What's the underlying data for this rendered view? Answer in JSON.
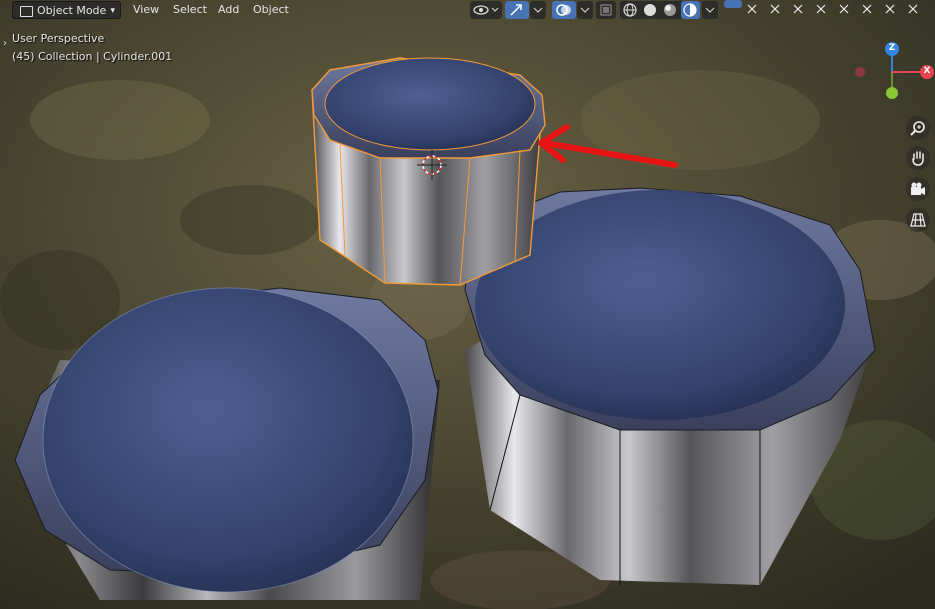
{
  "header": {
    "mode_label": "Object Mode",
    "menus": [
      "View",
      "Select",
      "Add",
      "Object"
    ]
  },
  "info": {
    "perspective": "User Perspective",
    "collection": "(45) Collection | Cylinder.001"
  },
  "gizmo": {
    "z_label": "Z",
    "x_label": "X",
    "colors": {
      "x": "#e8434e",
      "y": "#8bc734",
      "z": "#2f83e4"
    }
  },
  "icons": {
    "view_buttons": [
      "eye-icon",
      "transform-icon",
      "overlay-icon",
      "xray-icon",
      "wireframe-shading-icon",
      "solid-shading-icon",
      "material-shading-icon",
      "rendered-shading-icon"
    ],
    "nav_buttons": [
      "zoom-icon",
      "hand-pan-icon",
      "camera-icon",
      "grid-icon"
    ]
  },
  "colors": {
    "selection": "#f09a3c",
    "arrow": "#e81414",
    "header_bg": "#282828",
    "active_blue": "#4772b3"
  }
}
